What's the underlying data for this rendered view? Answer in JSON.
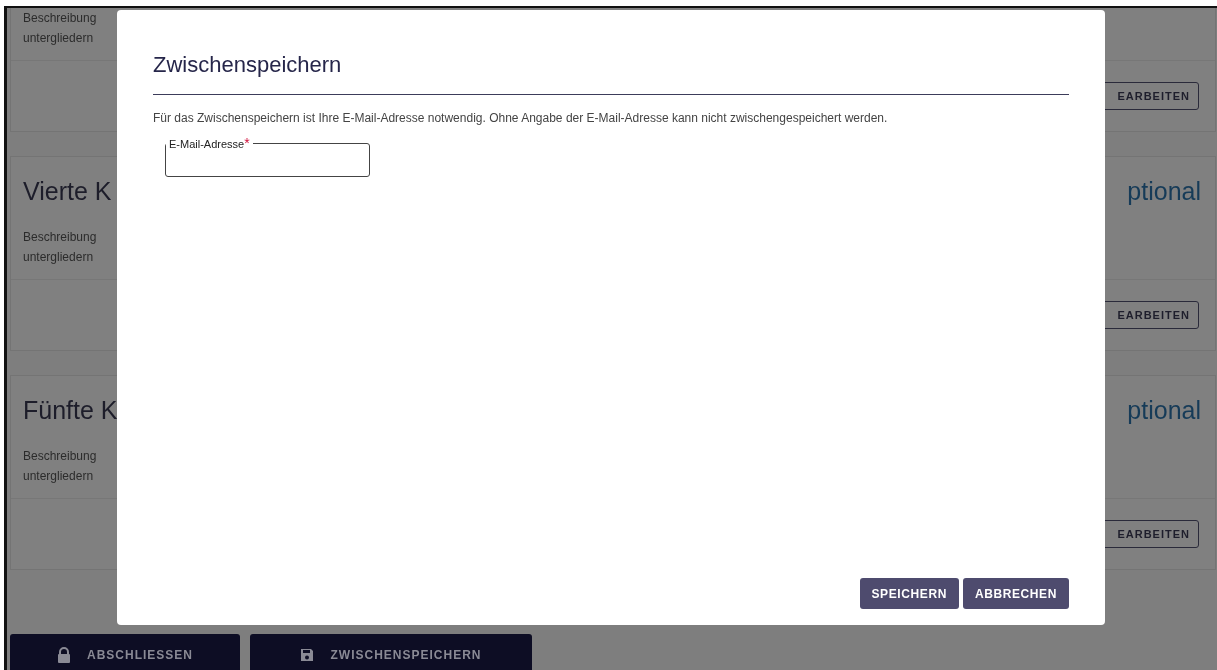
{
  "background_cards": [
    {
      "description": [
        "Beschreibung",
        "untergliedern"
      ],
      "button": "EARBEITEN"
    },
    {
      "title": "Vierte K",
      "description": [
        "Beschreibung",
        "untergliedern"
      ],
      "badge": "ptional",
      "button": "EARBEITEN"
    },
    {
      "title": "Fünfte K",
      "description": [
        "Beschreibung",
        "untergliedern"
      ],
      "badge": "ptional",
      "button": "EARBEITEN"
    }
  ],
  "footer_buttons": [
    {
      "label": "ABSCHLIESSEN",
      "kind": "lock"
    },
    {
      "label": "ZWISCHENSPEICHERN",
      "kind": "save"
    }
  ],
  "dialog": {
    "title": "Zwischenspeichern",
    "message": "Für das Zwischenspeichern ist Ihre E-Mail-Adresse notwendig. Ohne Angabe der E-Mail-Adresse kann nicht zwischengespeichert werden.",
    "field": {
      "label": "E-Mail-Adresse",
      "required_mark": "*"
    },
    "buttons": [
      "SPEICHERN",
      "ABBRECHEN"
    ]
  }
}
